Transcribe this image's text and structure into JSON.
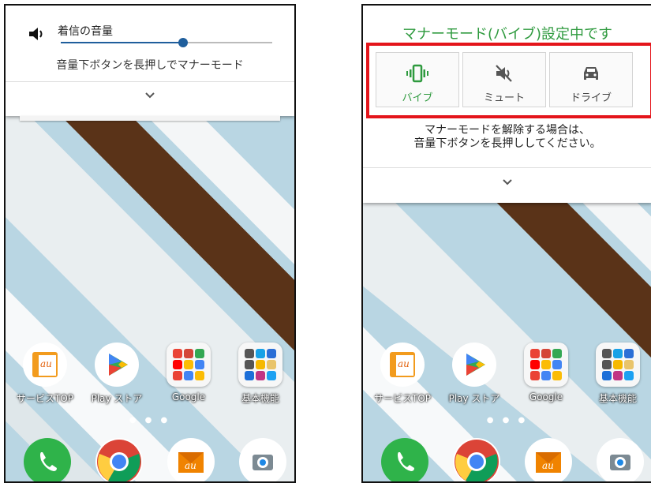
{
  "left_screen": {
    "volume_panel": {
      "title": "着信の音量",
      "level_percent": 58,
      "hint": "音量下ボタンを長押しでマナーモード",
      "expand_icon": "chevron-down-icon"
    }
  },
  "right_screen": {
    "manner_panel": {
      "status": "マナーモード(バイブ)設定中です",
      "modes": [
        {
          "label": "バイブ",
          "icon": "vibrate-icon",
          "active": true
        },
        {
          "label": "ミュート",
          "icon": "mute-icon",
          "active": false
        },
        {
          "label": "ドライブ",
          "icon": "car-icon",
          "active": false
        }
      ],
      "release_line1": "マナーモードを解除する場合は、",
      "release_line2": "音量下ボタンを長押ししてください。",
      "expand_icon": "chevron-down-icon"
    }
  },
  "home": {
    "apps": [
      {
        "label": "サービスTOP",
        "icon": "au-service-icon"
      },
      {
        "label": "Play ストア",
        "icon": "play-store-icon"
      },
      {
        "label": "Google",
        "icon": "google-folder-icon"
      },
      {
        "label": "基本機能",
        "icon": "basic-functions-folder-icon"
      }
    ],
    "dock": [
      {
        "icon": "phone-icon"
      },
      {
        "icon": "chrome-icon"
      },
      {
        "icon": "au-mail-icon"
      },
      {
        "icon": "camera-icon"
      }
    ],
    "au_text": "au"
  },
  "colors": {
    "accent_green": "#2e9a3e",
    "highlight_red": "#e4151b",
    "slider_blue": "#1f5e9c"
  }
}
